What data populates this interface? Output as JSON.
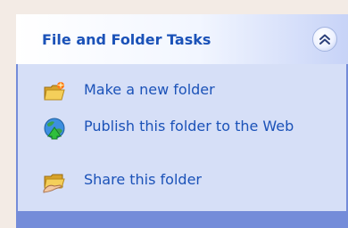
{
  "panel": {
    "title": "File and Folder Tasks",
    "collapse_button_icon": "double-chevron-up-icon",
    "tasks": [
      {
        "label": "Make a new folder",
        "icon": "new-folder-icon"
      },
      {
        "label": "Publish this folder to the Web",
        "icon": "publish-web-icon"
      },
      {
        "label": "Share this folder",
        "icon": "share-folder-icon"
      }
    ]
  },
  "colors": {
    "title_text": "#1b52b8",
    "link_text": "#1b52b8",
    "panel_body": "#d6dff7",
    "panel_frame": "#748cd9",
    "background": "#f3ebe5"
  }
}
